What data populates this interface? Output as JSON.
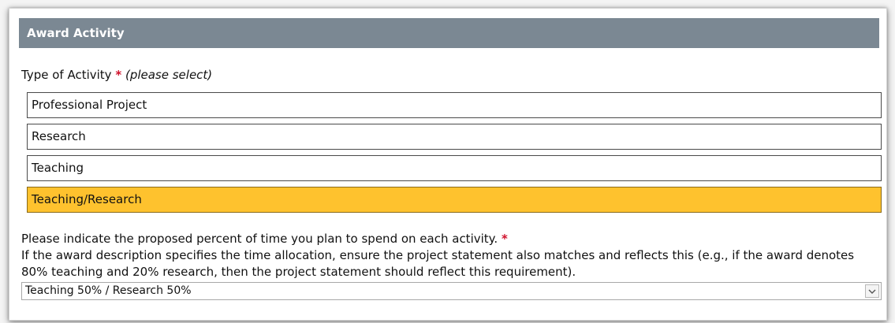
{
  "section": {
    "title": "Award Activity"
  },
  "activity_type": {
    "label": "Type of Activity",
    "required_mark": "*",
    "hint": "(please select)",
    "options": [
      {
        "label": "Professional Project",
        "selected": false
      },
      {
        "label": "Research",
        "selected": false
      },
      {
        "label": "Teaching",
        "selected": false
      },
      {
        "label": "Teaching/Research",
        "selected": true
      }
    ]
  },
  "time_allocation": {
    "prompt": "Please indicate the proposed percent of time you plan to spend on each activity.",
    "required_mark": "*",
    "note": "If the award description specifies the time allocation, ensure the project statement also matches and reflects this (e.g., if the award denotes 80% teaching and 20% research, then the project statement should reflect this requirement).",
    "selected_value": "Teaching 50% / Research 50%"
  },
  "icons": {
    "dropdown": "chevron-down-icon"
  },
  "colors": {
    "header_bg": "#7b8893",
    "selected_bg": "#fec22e",
    "required": "#d0112b"
  }
}
